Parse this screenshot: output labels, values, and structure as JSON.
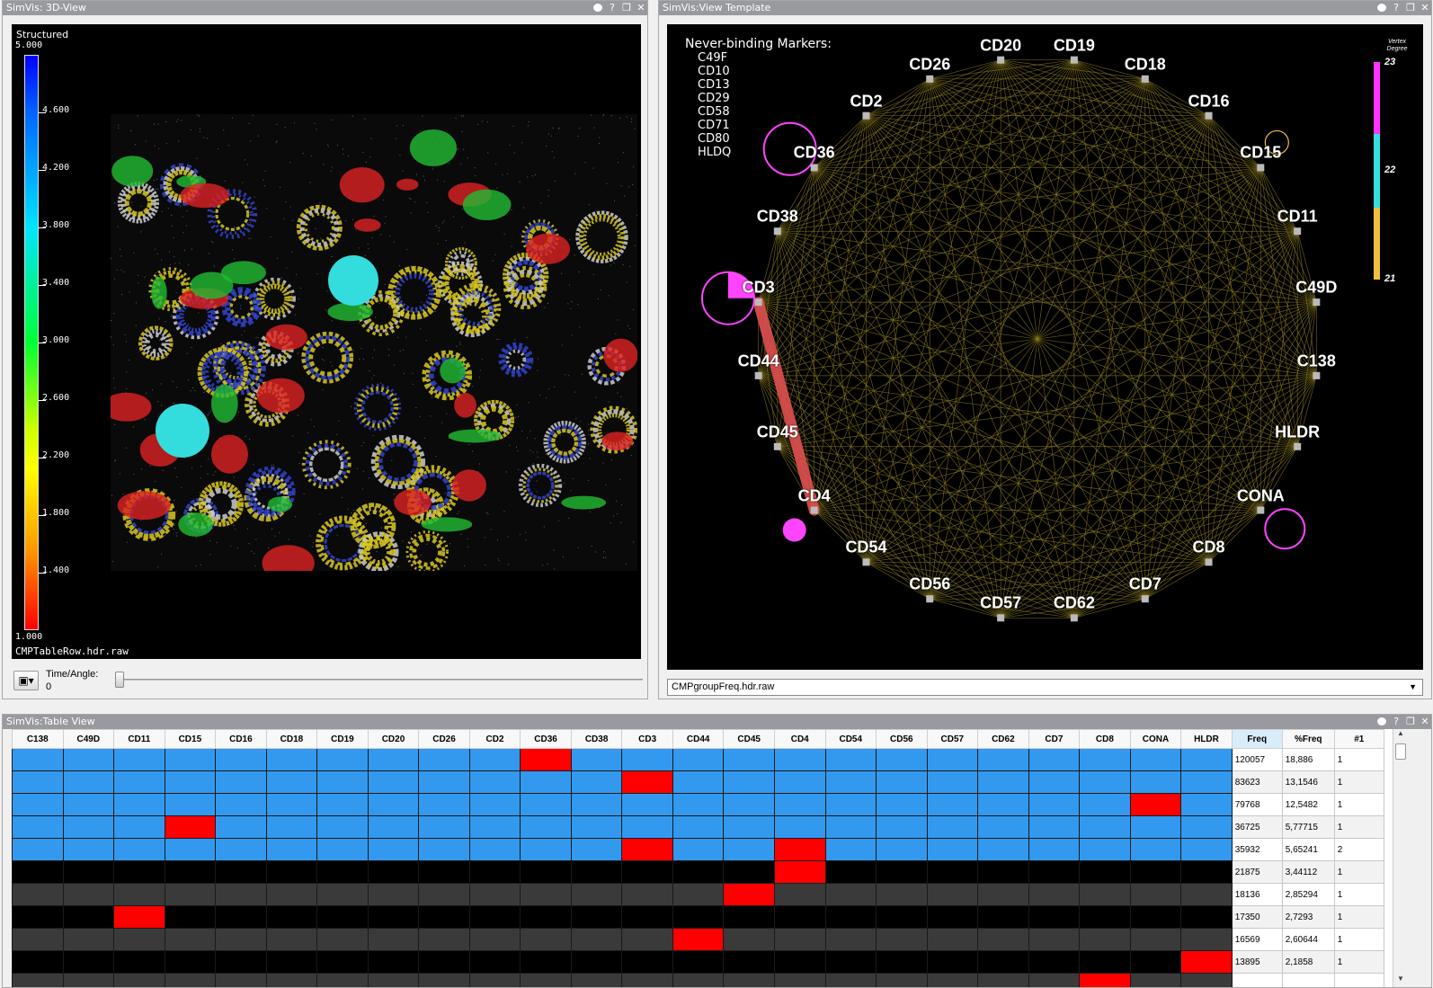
{
  "view3d": {
    "title": "SimVis: 3D-View",
    "legend_title": "Structured",
    "legend_ticks": [
      "5.000",
      "4.600",
      "4.200",
      "3.800",
      "3.400",
      "3.000",
      "2.600",
      "2.200",
      "1.800",
      "1.400",
      "1.000"
    ],
    "file_label": "CMPTableRow.hdr.raw",
    "time_label": "Time/Angle:",
    "time_value": "0"
  },
  "graph": {
    "title": "SimVis:View Template",
    "never_title": "Never-binding Markers:",
    "never_markers": [
      "C49F",
      "CD10",
      "CD13",
      "CD29",
      "CD58",
      "CD71",
      "CD80",
      "HLDQ"
    ],
    "nodes": [
      "CD19",
      "CD18",
      "CD16",
      "CD15",
      "CD11",
      "C49D",
      "C138",
      "HLDR",
      "CONA",
      "CD8",
      "CD7",
      "CD62",
      "CD57",
      "CD56",
      "CD54",
      "CD4",
      "CD45",
      "CD44",
      "CD3",
      "CD38",
      "CD36",
      "CD2",
      "CD26",
      "CD20"
    ],
    "vertex_degree_title": "Vertex Degree",
    "vertex_degree_labels": [
      "23",
      "22",
      "21"
    ],
    "dropdown_value": "CMPgroupFreq.hdr.raw",
    "colors": {
      "edges": "#8a7a20",
      "highlight_edge": "#e05050",
      "ring": "#ff44ff"
    }
  },
  "table": {
    "title": "SimVis:Table View",
    "columns": [
      "C138",
      "C49D",
      "CD11",
      "CD15",
      "CD16",
      "CD18",
      "CD19",
      "CD20",
      "CD26",
      "CD2",
      "CD36",
      "CD38",
      "CD3",
      "CD44",
      "CD45",
      "CD4",
      "CD54",
      "CD56",
      "CD57",
      "CD62",
      "CD7",
      "CD8",
      "CONA",
      "HLDR"
    ],
    "stat_columns": [
      "Freq",
      "%Freq",
      "#1"
    ],
    "rows": [
      {
        "style": "blue",
        "red": [
          "CD36"
        ],
        "freq": "120057",
        "pfreq": "18,886",
        "n": "1"
      },
      {
        "style": "blue",
        "red": [
          "CD3"
        ],
        "freq": "83623",
        "pfreq": "13,1546",
        "n": "1"
      },
      {
        "style": "blue",
        "red": [
          "CONA"
        ],
        "freq": "79768",
        "pfreq": "12,5482",
        "n": "1"
      },
      {
        "style": "blue",
        "red": [
          "CD15"
        ],
        "freq": "36725",
        "pfreq": "5,77715",
        "n": "1"
      },
      {
        "style": "blue",
        "red": [
          "CD3",
          "CD4"
        ],
        "freq": "35932",
        "pfreq": "5,65241",
        "n": "2"
      },
      {
        "style": "black",
        "red": [
          "CD4"
        ],
        "freq": "21875",
        "pfreq": "3,44112",
        "n": "1"
      },
      {
        "style": "dark",
        "red": [
          "CD45"
        ],
        "freq": "18136",
        "pfreq": "2,85294",
        "n": "1"
      },
      {
        "style": "black",
        "red": [
          "CD11"
        ],
        "freq": "17350",
        "pfreq": "2,7293",
        "n": "1"
      },
      {
        "style": "dark",
        "red": [
          "CD44"
        ],
        "freq": "16569",
        "pfreq": "2,60644",
        "n": "1"
      },
      {
        "style": "black",
        "red": [
          "HLDR"
        ],
        "freq": "13895",
        "pfreq": "2,1858",
        "n": "1"
      },
      {
        "style": "dark",
        "red": [
          "CD8"
        ],
        "freq": "",
        "pfreq": "",
        "n": ""
      }
    ]
  }
}
